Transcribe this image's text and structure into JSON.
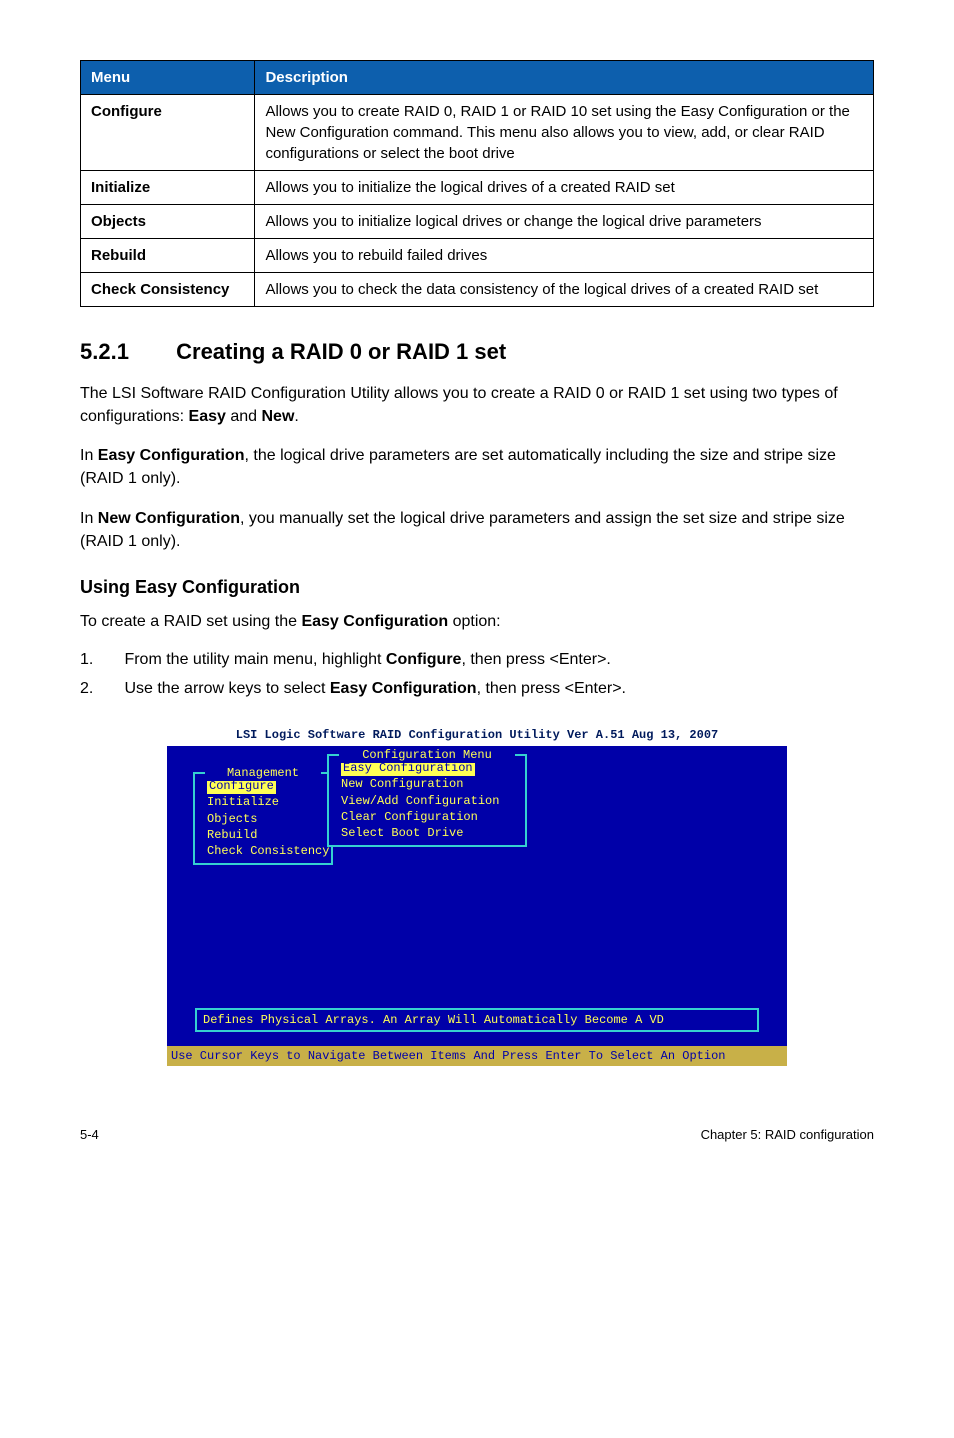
{
  "table": {
    "headers": [
      "Menu",
      "Description"
    ],
    "rows": [
      {
        "menu": "Configure",
        "desc": "Allows you to create RAID 0, RAID 1 or RAID 10 set using the Easy Configuration or the New Configuration command. This menu also allows you to view, add, or clear RAID configurations or select the boot drive"
      },
      {
        "menu": "Initialize",
        "desc": "Allows you to initialize the logical drives of a created RAID set"
      },
      {
        "menu": "Objects",
        "desc": "Allows you to initialize logical drives or change the logical drive parameters"
      },
      {
        "menu": "Rebuild",
        "desc": "Allows you to rebuild failed drives"
      },
      {
        "menu": "Check Consistency",
        "desc": "Allows you to check the data consistency of the logical drives of a created RAID set"
      }
    ]
  },
  "section": {
    "num": "5.2.1",
    "title": "Creating a RAID 0 or RAID 1 set"
  },
  "p1a": "The LSI Software RAID Configuration Utility allows you to create a RAID 0 or RAID 1 set using two types of configurations: ",
  "p1b": "Easy",
  "p1c": " and ",
  "p1d": "New",
  "p1e": ".",
  "p2a": "In ",
  "p2b": "Easy Configuration",
  "p2c": ", the logical drive parameters are set automatically including the size and stripe size (RAID 1 only).",
  "p3a": "In ",
  "p3b": "New Configuration",
  "p3c": ", you manually set the logical drive parameters and assign the set size and stripe size (RAID 1 only).",
  "sub": "Using Easy Configuration",
  "p4a": "To create a RAID set using the ",
  "p4b": "Easy Configuration",
  "p4c": " option:",
  "steps": {
    "s1n": "1.",
    "s1a": "From the utility main menu, highlight ",
    "s1b": "Configure",
    "s1c": ", then press <Enter>.",
    "s2n": "2.",
    "s2a": "Use the arrow keys to select ",
    "s2b": "Easy Configuration",
    "s2c": ", then press <Enter>."
  },
  "terminal": {
    "title": "LSI Logic Software RAID Configuration Utility Ver A.51 Aug 13, 2007",
    "mgmt_title": "Management",
    "mgmt_items": [
      "Configure",
      "Initialize",
      "Objects",
      "Rebuild",
      "Check Consistency"
    ],
    "cfg_title": "Configuration Menu",
    "cfg_items": [
      "Easy Configuration",
      "New Configuration",
      "View/Add Configuration",
      "Clear Configuration",
      "Select Boot Drive"
    ],
    "desc": "Defines Physical Arrays. An Array Will Automatically Become A VD",
    "status": "Use Cursor Keys to Navigate Between Items And Press Enter To Select An Option"
  },
  "footer": {
    "left": "5-4",
    "right": "Chapter 5: RAID configuration"
  }
}
